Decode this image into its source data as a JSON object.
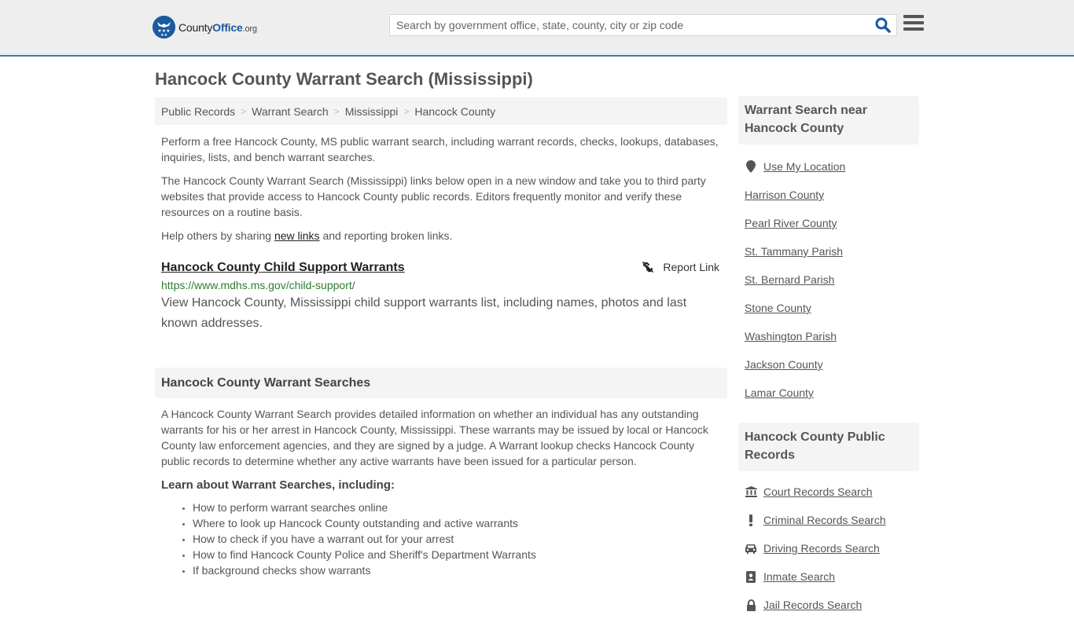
{
  "header": {
    "logo": {
      "name_part1": "County",
      "name_part2": "Office",
      "tld": ".org"
    },
    "search": {
      "placeholder": "Search by government office, state, county, city or zip code",
      "value": ""
    },
    "colors": {
      "brand": "#1a5aa0",
      "header_border": "#3a7cae"
    }
  },
  "page": {
    "title": "Hancock County Warrant Search (Mississippi)"
  },
  "breadcrumb": [
    {
      "label": "Public Records"
    },
    {
      "label": "Warrant Search"
    },
    {
      "label": "Mississippi"
    },
    {
      "label": "Hancock County"
    }
  ],
  "intro": {
    "p1": "Perform a free Hancock County, MS public warrant search, including warrant records, checks, lookups, databases, inquiries, lists, and bench warrant searches.",
    "p2": "The Hancock County Warrant Search (Mississippi) links below open in a new window and take you to third party websites that provide access to Hancock County public records. Editors frequently monitor and verify these resources on a routine basis.",
    "p3_before": "Help others by sharing ",
    "p3_link": "new links",
    "p3_after": " and reporting broken links."
  },
  "results": [
    {
      "title": "Hancock County Child Support Warrants",
      "url": "https://www.mdhs.ms.gov/child-support/",
      "description": "View Hancock County, Mississippi child support warrants list, including names, photos and last known addresses.",
      "report_label": "Report Link"
    }
  ],
  "warrant_searches": {
    "heading": "Hancock County Warrant Searches",
    "body": "A Hancock County Warrant Search provides detailed information on whether an individual has any outstanding warrants for his or her arrest in Hancock County, Mississippi. These warrants may be issued by local or Hancock County law enforcement agencies, and they are signed by a judge. A Warrant lookup checks Hancock County public records to determine whether any active warrants have been issued for a particular person.",
    "learn_heading": "Learn about Warrant Searches, including:",
    "learn_items": [
      "How to perform warrant searches online",
      "Where to look up Hancock County outstanding and active warrants",
      "How to check if you have a warrant out for your arrest",
      "How to find Hancock County Police and Sheriff's Department Warrants",
      "If background checks show warrants"
    ]
  },
  "sidebar": {
    "nearby": {
      "heading": "Warrant Search near Hancock County",
      "use_location": {
        "label": "Use My Location",
        "icon": "map-marker-icon"
      },
      "items": [
        "Harrison County",
        "Pearl River County",
        "St. Tammany Parish",
        "St. Bernard Parish",
        "Stone County",
        "Washington Parish",
        "Jackson County",
        "Lamar County"
      ]
    },
    "public_records": {
      "heading": "Hancock County Public Records",
      "items": [
        {
          "label": "Court Records Search",
          "icon": "courthouse-icon"
        },
        {
          "label": "Criminal Records Search",
          "icon": "exclamation-icon"
        },
        {
          "label": "Driving Records Search",
          "icon": "car-icon"
        },
        {
          "label": "Inmate Search",
          "icon": "id-badge-icon"
        },
        {
          "label": "Jail Records Search",
          "icon": "lock-icon"
        }
      ]
    }
  }
}
